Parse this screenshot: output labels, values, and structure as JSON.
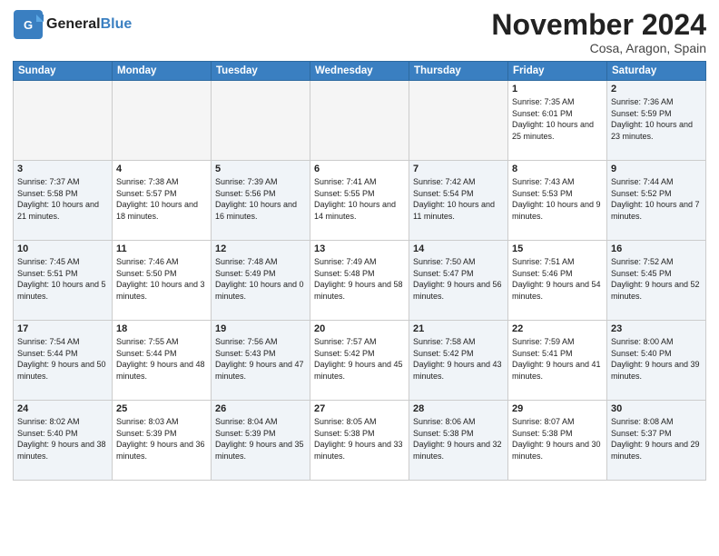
{
  "logo": {
    "line1a": "General",
    "line1b": "Blue",
    "tagline": ""
  },
  "title": "November 2024",
  "location": "Cosa, Aragon, Spain",
  "weekdays": [
    "Sunday",
    "Monday",
    "Tuesday",
    "Wednesday",
    "Thursday",
    "Friday",
    "Saturday"
  ],
  "weeks": [
    [
      {
        "day": "",
        "info": ""
      },
      {
        "day": "",
        "info": ""
      },
      {
        "day": "",
        "info": ""
      },
      {
        "day": "",
        "info": ""
      },
      {
        "day": "",
        "info": ""
      },
      {
        "day": "1",
        "info": "Sunrise: 7:35 AM\nSunset: 6:01 PM\nDaylight: 10 hours\nand 25 minutes."
      },
      {
        "day": "2",
        "info": "Sunrise: 7:36 AM\nSunset: 5:59 PM\nDaylight: 10 hours\nand 23 minutes."
      }
    ],
    [
      {
        "day": "3",
        "info": "Sunrise: 7:37 AM\nSunset: 5:58 PM\nDaylight: 10 hours\nand 21 minutes."
      },
      {
        "day": "4",
        "info": "Sunrise: 7:38 AM\nSunset: 5:57 PM\nDaylight: 10 hours\nand 18 minutes."
      },
      {
        "day": "5",
        "info": "Sunrise: 7:39 AM\nSunset: 5:56 PM\nDaylight: 10 hours\nand 16 minutes."
      },
      {
        "day": "6",
        "info": "Sunrise: 7:41 AM\nSunset: 5:55 PM\nDaylight: 10 hours\nand 14 minutes."
      },
      {
        "day": "7",
        "info": "Sunrise: 7:42 AM\nSunset: 5:54 PM\nDaylight: 10 hours\nand 11 minutes."
      },
      {
        "day": "8",
        "info": "Sunrise: 7:43 AM\nSunset: 5:53 PM\nDaylight: 10 hours\nand 9 minutes."
      },
      {
        "day": "9",
        "info": "Sunrise: 7:44 AM\nSunset: 5:52 PM\nDaylight: 10 hours\nand 7 minutes."
      }
    ],
    [
      {
        "day": "10",
        "info": "Sunrise: 7:45 AM\nSunset: 5:51 PM\nDaylight: 10 hours\nand 5 minutes."
      },
      {
        "day": "11",
        "info": "Sunrise: 7:46 AM\nSunset: 5:50 PM\nDaylight: 10 hours\nand 3 minutes."
      },
      {
        "day": "12",
        "info": "Sunrise: 7:48 AM\nSunset: 5:49 PM\nDaylight: 10 hours\nand 0 minutes."
      },
      {
        "day": "13",
        "info": "Sunrise: 7:49 AM\nSunset: 5:48 PM\nDaylight: 9 hours\nand 58 minutes."
      },
      {
        "day": "14",
        "info": "Sunrise: 7:50 AM\nSunset: 5:47 PM\nDaylight: 9 hours\nand 56 minutes."
      },
      {
        "day": "15",
        "info": "Sunrise: 7:51 AM\nSunset: 5:46 PM\nDaylight: 9 hours\nand 54 minutes."
      },
      {
        "day": "16",
        "info": "Sunrise: 7:52 AM\nSunset: 5:45 PM\nDaylight: 9 hours\nand 52 minutes."
      }
    ],
    [
      {
        "day": "17",
        "info": "Sunrise: 7:54 AM\nSunset: 5:44 PM\nDaylight: 9 hours\nand 50 minutes."
      },
      {
        "day": "18",
        "info": "Sunrise: 7:55 AM\nSunset: 5:44 PM\nDaylight: 9 hours\nand 48 minutes."
      },
      {
        "day": "19",
        "info": "Sunrise: 7:56 AM\nSunset: 5:43 PM\nDaylight: 9 hours\nand 47 minutes."
      },
      {
        "day": "20",
        "info": "Sunrise: 7:57 AM\nSunset: 5:42 PM\nDaylight: 9 hours\nand 45 minutes."
      },
      {
        "day": "21",
        "info": "Sunrise: 7:58 AM\nSunset: 5:42 PM\nDaylight: 9 hours\nand 43 minutes."
      },
      {
        "day": "22",
        "info": "Sunrise: 7:59 AM\nSunset: 5:41 PM\nDaylight: 9 hours\nand 41 minutes."
      },
      {
        "day": "23",
        "info": "Sunrise: 8:00 AM\nSunset: 5:40 PM\nDaylight: 9 hours\nand 39 minutes."
      }
    ],
    [
      {
        "day": "24",
        "info": "Sunrise: 8:02 AM\nSunset: 5:40 PM\nDaylight: 9 hours\nand 38 minutes."
      },
      {
        "day": "25",
        "info": "Sunrise: 8:03 AM\nSunset: 5:39 PM\nDaylight: 9 hours\nand 36 minutes."
      },
      {
        "day": "26",
        "info": "Sunrise: 8:04 AM\nSunset: 5:39 PM\nDaylight: 9 hours\nand 35 minutes."
      },
      {
        "day": "27",
        "info": "Sunrise: 8:05 AM\nSunset: 5:38 PM\nDaylight: 9 hours\nand 33 minutes."
      },
      {
        "day": "28",
        "info": "Sunrise: 8:06 AM\nSunset: 5:38 PM\nDaylight: 9 hours\nand 32 minutes."
      },
      {
        "day": "29",
        "info": "Sunrise: 8:07 AM\nSunset: 5:38 PM\nDaylight: 9 hours\nand 30 minutes."
      },
      {
        "day": "30",
        "info": "Sunrise: 8:08 AM\nSunset: 5:37 PM\nDaylight: 9 hours\nand 29 minutes."
      }
    ]
  ]
}
